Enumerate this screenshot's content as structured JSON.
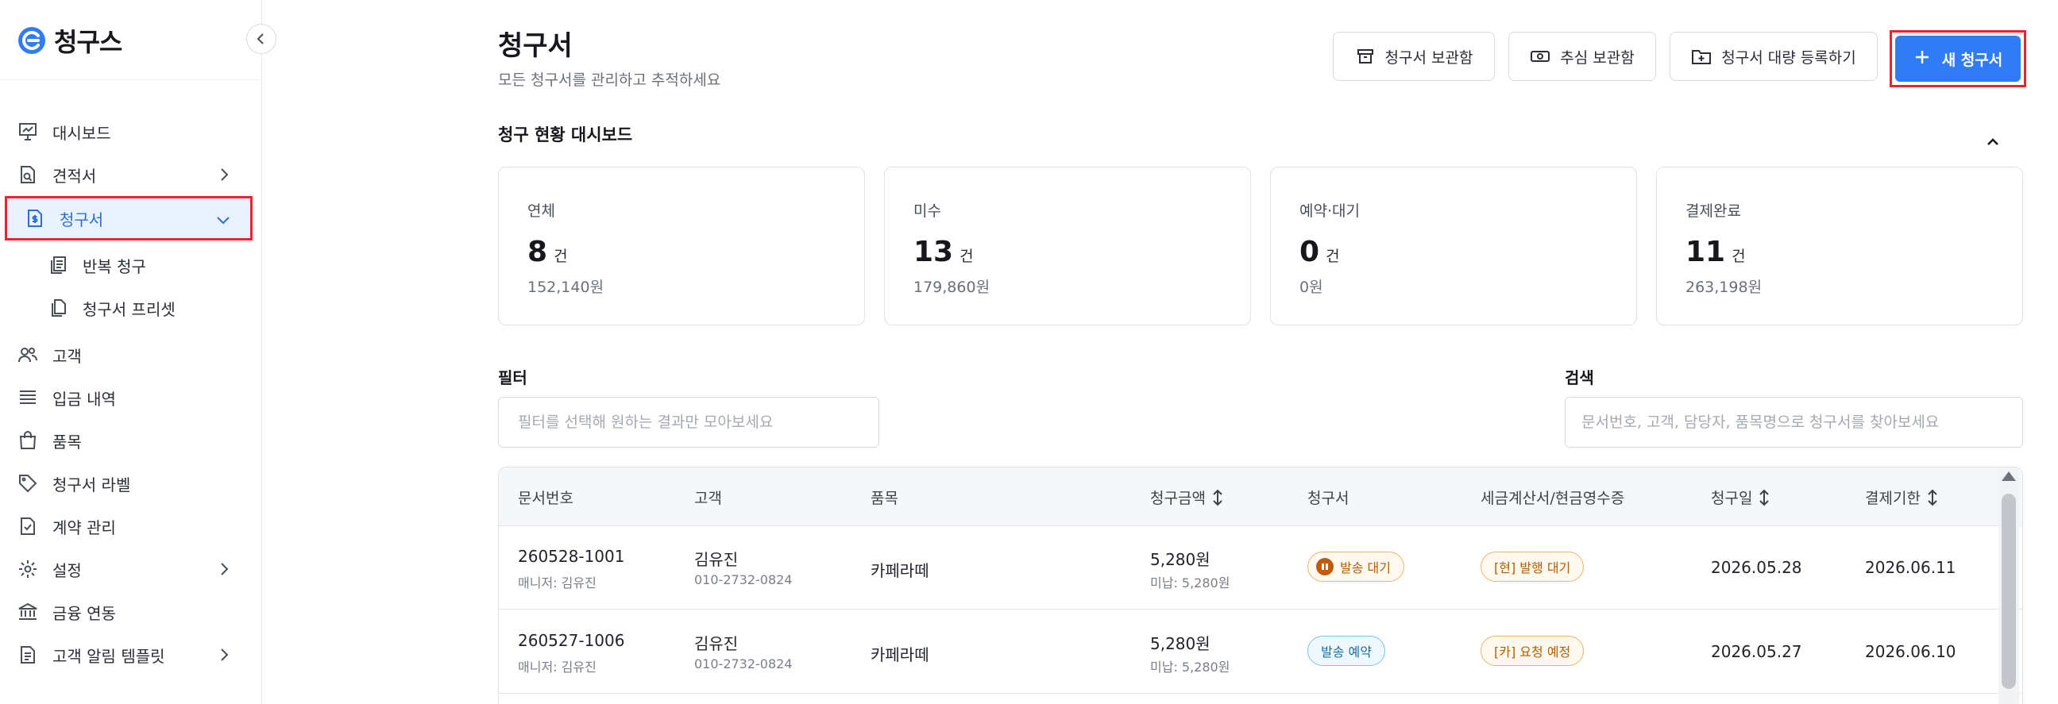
{
  "app": {
    "name": "청구스"
  },
  "sidebar": {
    "items": [
      {
        "label": "대시보드",
        "icon": "presentation-chart-icon"
      },
      {
        "label": "견적서",
        "icon": "quote-doc-icon",
        "has_chevron": true
      },
      {
        "label": "청구서",
        "icon": "invoice-doc-icon",
        "active": true,
        "expanded": true
      },
      {
        "label": "고객",
        "icon": "users-icon"
      },
      {
        "label": "입금 내역",
        "icon": "list-icon"
      },
      {
        "label": "품목",
        "icon": "shopping-bag-icon"
      },
      {
        "label": "청구서 라벨",
        "icon": "tag-icon"
      },
      {
        "label": "계약 관리",
        "icon": "contract-icon"
      },
      {
        "label": "설정",
        "icon": "gear-icon",
        "has_chevron": true
      },
      {
        "label": "금융 연동",
        "icon": "bank-icon"
      },
      {
        "label": "고객 알림 템플릿",
        "icon": "template-doc-icon",
        "has_chevron": true
      }
    ],
    "subitems": [
      {
        "label": "반복 청구",
        "icon": "stack-docs-icon"
      },
      {
        "label": "청구서 프리셋",
        "icon": "copy-docs-icon"
      }
    ]
  },
  "header": {
    "title": "청구서",
    "subtitle": "모든 청구서를 관리하고 추적하세요",
    "buttons": {
      "archive": "청구서 보관함",
      "collection": "추심 보관함",
      "bulk": "청구서 대량 등록하기",
      "new": "새 청구서"
    }
  },
  "dashboard": {
    "title": "청구 현황 대시보드",
    "cards": [
      {
        "label": "연체",
        "count": "8",
        "unit": "건",
        "amount": "152,140원"
      },
      {
        "label": "미수",
        "count": "13",
        "unit": "건",
        "amount": "179,860원"
      },
      {
        "label": "예약·대기",
        "count": "0",
        "unit": "건",
        "amount": "0원"
      },
      {
        "label": "결제완료",
        "count": "11",
        "unit": "건",
        "amount": "263,198원"
      }
    ]
  },
  "filter": {
    "label": "필터",
    "placeholder": "필터를 선택해 원하는 결과만 모아보세요"
  },
  "search": {
    "label": "검색",
    "placeholder": "문서번호, 고객, 담당자, 품목명으로 청구서를 찾아보세요"
  },
  "table": {
    "headers": {
      "doc_no": "문서번호",
      "customer": "고객",
      "item": "품목",
      "amount": "청구금액",
      "invoice": "청구서",
      "tax": "세금계산서/현금영수증",
      "date": "청구일",
      "due": "결제기한"
    },
    "rows": [
      {
        "doc_no": "260528-1001",
        "manager": "매니저: 김유진",
        "customer": "김유진",
        "phone": "010-2732-0824",
        "item": "카페라떼",
        "amount": "5,280원",
        "unpaid": "미납: 5,280원",
        "status": "발송 대기",
        "tax": "[현] 발행 대기",
        "date": "2026.05.28",
        "due": "2026.06.11"
      },
      {
        "doc_no": "260527-1006",
        "manager": "매니저: 김유진",
        "customer": "김유진",
        "phone": "010-2732-0824",
        "item": "카페라떼",
        "amount": "5,280원",
        "unpaid": "미납: 5,280원",
        "status": "발송 예약",
        "tax": "[카] 요청 예정",
        "date": "2026.05.27",
        "due": "2026.06.10"
      }
    ]
  },
  "colors": {
    "accent": "#2f7cf6",
    "highlight": "#e5262c",
    "active_bg": "#e9f1fd"
  }
}
